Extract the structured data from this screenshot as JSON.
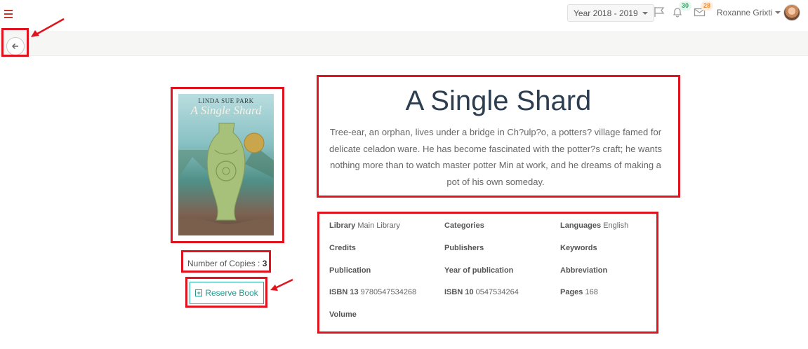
{
  "header": {
    "year_selector": "Year 2018 - 2019",
    "notifications_count": "30",
    "messages_count": "28",
    "user_name": "Roxanne Grixti"
  },
  "book": {
    "title": "A Single Shard",
    "description": "Tree-ear, an orphan, lives under a bridge in Ch?ulp?o, a potters? village famed for delicate celadon ware. He has become fascinated with the potter?s craft; he wants nothing more than to watch master potter Min at work, and he dreams of making a pot of his own someday.",
    "cover_author": "LINDA SUE PARK",
    "cover_title": "A Single Shard",
    "copies_label": "Number of Copies :",
    "copies_value": "3",
    "reserve_label": "Reserve Book"
  },
  "details": [
    {
      "label": "Library",
      "value": "Main Library"
    },
    {
      "label": "Categories",
      "value": ""
    },
    {
      "label": "Languages",
      "value": "English"
    },
    {
      "label": "Credits",
      "value": ""
    },
    {
      "label": "Publishers",
      "value": ""
    },
    {
      "label": "Keywords",
      "value": ""
    },
    {
      "label": "Publication",
      "value": ""
    },
    {
      "label": "Year of publication",
      "value": ""
    },
    {
      "label": "Abbreviation",
      "value": ""
    },
    {
      "label": "ISBN 13",
      "value": "9780547534268"
    },
    {
      "label": "ISBN 10",
      "value": "0547534264"
    },
    {
      "label": "Pages",
      "value": "168"
    },
    {
      "label": "Volume",
      "value": ""
    }
  ],
  "colors": {
    "highlight": "#e0141e",
    "accent": "#1f9a8d",
    "title": "#2c3e50"
  },
  "icons": [
    "menu-icon",
    "back-arrow-icon",
    "flag-icon",
    "bell-icon",
    "envelope-icon",
    "plus-square-icon"
  ]
}
